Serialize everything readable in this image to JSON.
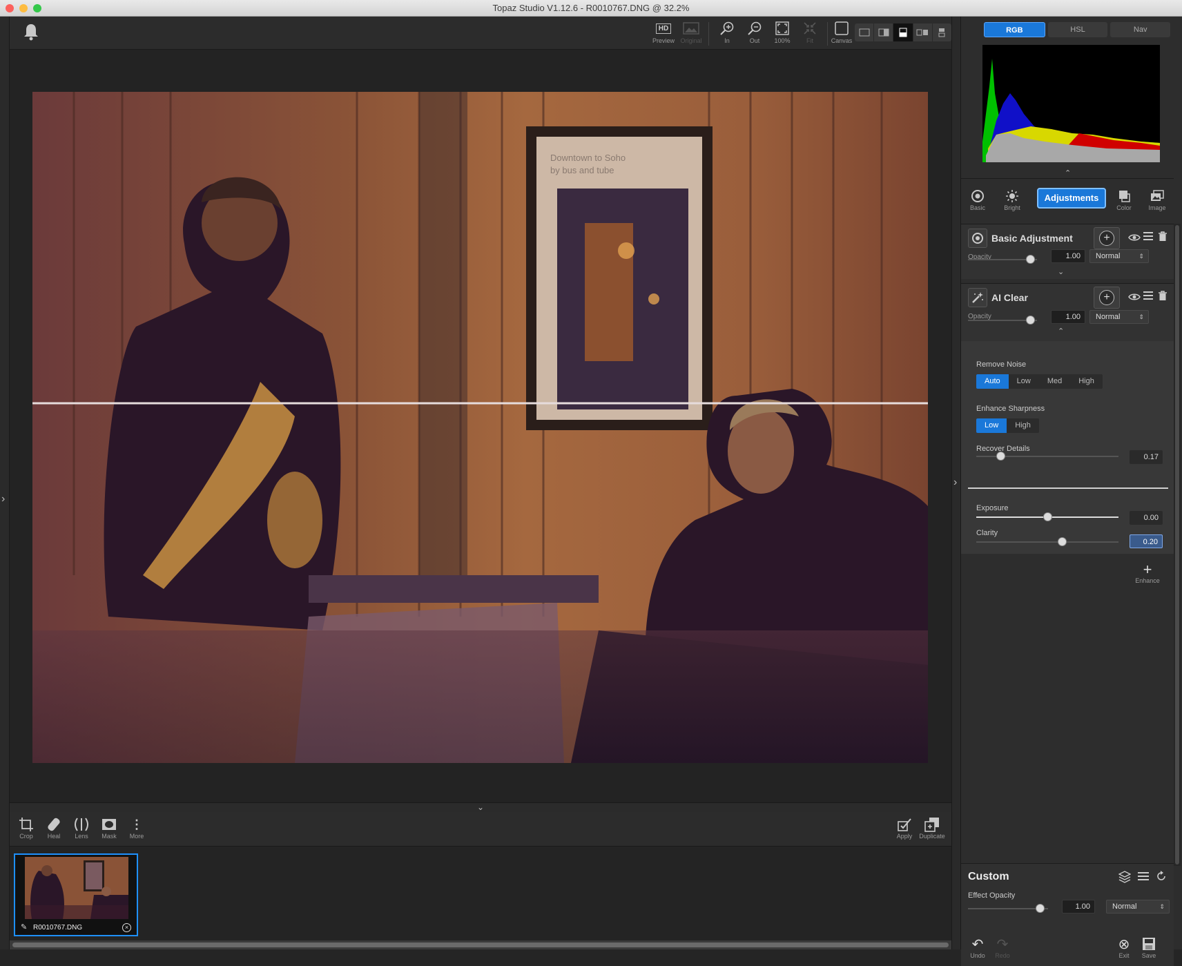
{
  "window": {
    "title": "Topaz Studio V1.12.6 - R0010767.DNG @ 32.2%"
  },
  "toolbar": {
    "preview": "Preview",
    "original": "Original",
    "zoom_in": "In",
    "zoom_out": "Out",
    "zoom_100": "100%",
    "fit": "Fit",
    "canvas": "Canvas",
    "hd_badge": "HD"
  },
  "bottom_tools": {
    "crop": "Crop",
    "heal": "Heal",
    "lens": "Lens",
    "mask": "Mask",
    "more": "More",
    "apply": "Apply",
    "duplicate": "Duplicate"
  },
  "filmstrip": {
    "filename": "R0010767.DNG"
  },
  "histogram_tabs": [
    "RGB",
    "HSL",
    "Nav"
  ],
  "categories": {
    "basic": "Basic",
    "bright": "Bright",
    "adjustments": "Adjustments",
    "color": "Color",
    "image": "Image"
  },
  "filters": [
    {
      "title": "Basic Adjustment",
      "opacity_label": "Opacity",
      "opacity": "1.00",
      "opacity_level": 0.9,
      "blend": "Normal"
    },
    {
      "title": "AI Clear",
      "opacity_label": "Opacity",
      "opacity": "1.00",
      "opacity_level": 0.9,
      "blend": "Normal"
    }
  ],
  "ai_clear": {
    "remove_noise_label": "Remove Noise",
    "remove_noise_options": [
      "Auto",
      "Low",
      "Med",
      "High"
    ],
    "remove_noise_selected": "Auto",
    "sharpness_label": "Enhance Sharpness",
    "sharpness_options": [
      "Low",
      "High"
    ],
    "sharpness_selected": "Low",
    "recover_label": "Recover Details",
    "recover_value": "0.17",
    "recover_level": 0.17
  },
  "basic_adjust": {
    "exposure_label": "Exposure",
    "exposure_value": "0.00",
    "exposure_level": 0.5,
    "clarity_label": "Clarity",
    "clarity_value": "0.20",
    "clarity_level": 0.6
  },
  "enhance_label": "Enhance",
  "custom": {
    "title": "Custom",
    "effect_opacity_label": "Effect Opacity",
    "effect_opacity": "1.00",
    "effect_opacity_level": 0.9,
    "blend": "Normal",
    "undo": "Undo",
    "redo": "Redo",
    "exit": "Exit",
    "save": "Save"
  },
  "photo": {
    "poster_line1": "Downtown to Soho",
    "poster_line2": "by bus and tube"
  }
}
